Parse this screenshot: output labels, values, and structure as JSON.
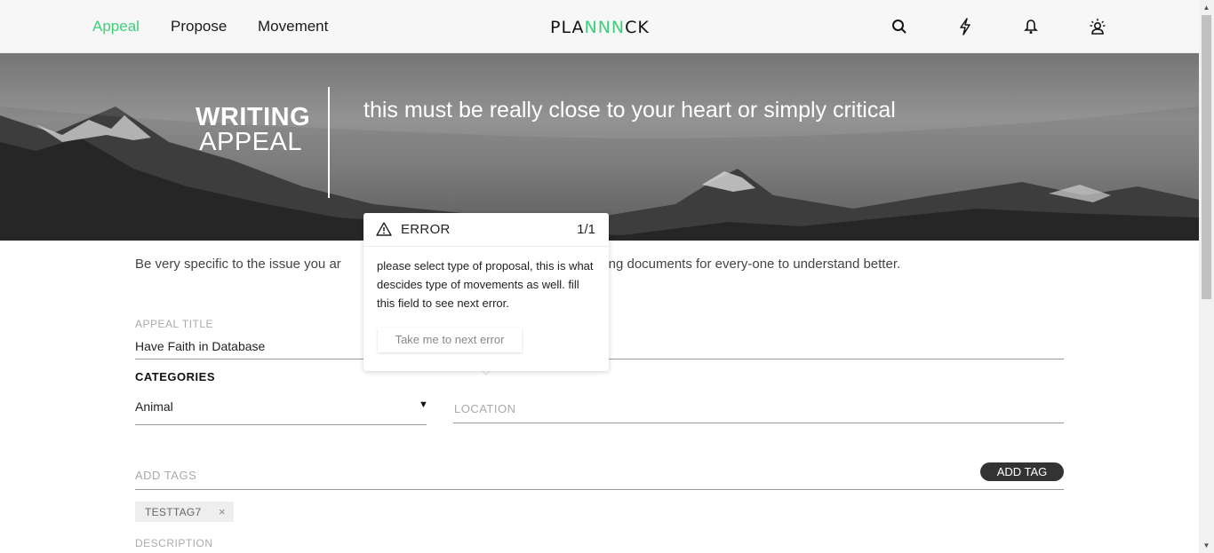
{
  "nav": {
    "links": [
      "Appeal",
      "Propose",
      "Movement"
    ],
    "logo_parts": [
      "PLA",
      "NNN",
      "CK"
    ],
    "icons": [
      "search-icon",
      "lightning-icon",
      "bell-icon",
      "profile-icon"
    ],
    "accent": "#3ecf7a"
  },
  "hero": {
    "title_line1": "WRITING",
    "title_line2": "APPEAL",
    "tagline": "this must be really close to your heart or simply critical"
  },
  "intro": {
    "left": "Be very specific to the issue you ar",
    "right": "orting documents for every-one to understand better."
  },
  "form": {
    "appeal_title_label": "APPEAL TITLE",
    "appeal_title_value": "Have Faith in Database",
    "categories_label": "CATEGORIES",
    "category_value": "Animal",
    "location_placeholder": "LOCATION",
    "tags_placeholder": "ADD TAGS",
    "add_tag_button": "ADD TAG",
    "tags": [
      "TESTTAG7"
    ],
    "description_label": "DESCRIPTION"
  },
  "error_popover": {
    "title": "ERROR",
    "count": "1/1",
    "message": "please select type of proposal, this is what descides type of movements as well. fill this field to see next error.",
    "next_button": "Take me to next error"
  }
}
